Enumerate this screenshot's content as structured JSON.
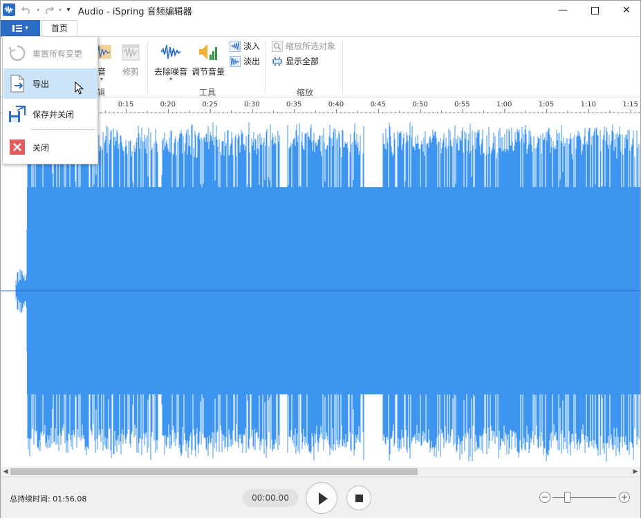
{
  "window": {
    "title": "Audio - iSpring 音频编辑器",
    "minimize_glyph": "—",
    "maximize_glyph": "☐",
    "close_glyph": "✕"
  },
  "quick_access": {
    "undo_icon": "undo-icon",
    "redo_icon": "redo-icon",
    "customize_glyph": "▾"
  },
  "tabs": [
    {
      "label": "首页"
    }
  ],
  "ribbon": {
    "edit_group": {
      "label": "编辑",
      "buttons": [
        {
          "label": "音"
        },
        {
          "label": "修剪"
        }
      ]
    },
    "tools_group": {
      "label": "工具",
      "buttons": [
        {
          "label": "去除噪音"
        },
        {
          "label": "调节音量"
        }
      ],
      "small": [
        {
          "label": "淡入"
        },
        {
          "label": "淡出"
        }
      ]
    },
    "zoom_group": {
      "label": "缩放",
      "small": [
        {
          "label": "缩放所选对象"
        },
        {
          "label": "显示全部"
        }
      ]
    }
  },
  "file_menu": {
    "items": [
      {
        "label": "重置所有变更",
        "disabled": true,
        "icon": "reset-icon"
      },
      {
        "label": "导出",
        "disabled": false,
        "icon": "export-icon"
      },
      {
        "label": "保存并关闭",
        "disabled": false,
        "icon": "save-close-icon"
      },
      {
        "label": "关闭",
        "disabled": false,
        "icon": "close-icon"
      }
    ]
  },
  "timeline": {
    "labels": [
      "0:15",
      "0:20",
      "0:25",
      "0:30",
      "0:35",
      "0:40",
      "0:45",
      "0:50",
      "0:55",
      "1:00",
      "1:05",
      "1:10",
      "1:15"
    ]
  },
  "player": {
    "duration": "总持续时间: 01:56.08",
    "current_time": "00:00.00"
  },
  "colors": {
    "accent": "#2b6cc4",
    "waveform": "#3d95f0",
    "menu_hover": "#cce4f7"
  }
}
